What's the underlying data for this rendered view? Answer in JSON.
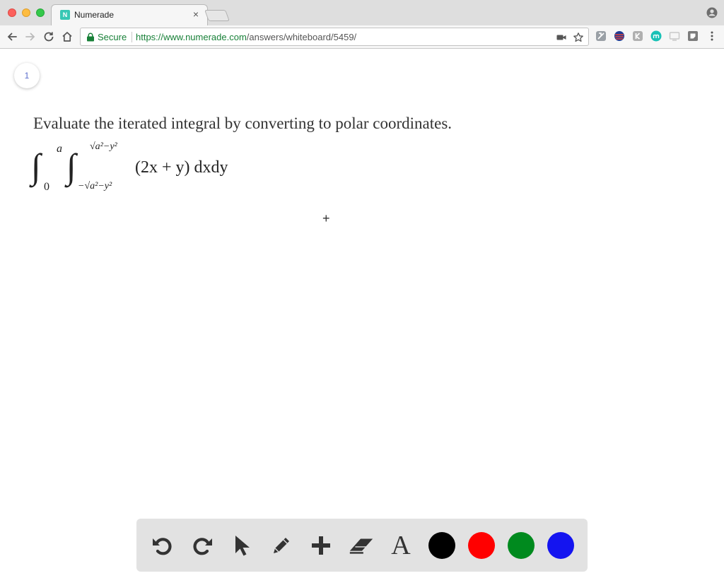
{
  "browser": {
    "tab_title": "Numerade",
    "tab_favicon": "N",
    "tab_close": "×",
    "secure_label": "Secure",
    "url_host": "https://www.numerade.com",
    "url_path": "/answers/whiteboard/5459/"
  },
  "page": {
    "page_number": "1",
    "question": "Evaluate the iterated integral by converting to polar coordinates.",
    "integral": {
      "outer_upper": "a",
      "outer_lower": "0",
      "inner_upper": "√a²−y²",
      "inner_lower": "−√a²−y²",
      "integrand": "(2x + y) dxdy"
    },
    "cursor": "+"
  },
  "tools": {
    "text_tool_label": "A",
    "colors": {
      "black": "#000000",
      "red": "#ff0000",
      "green": "#008a1e",
      "blue": "#1414f0"
    }
  }
}
